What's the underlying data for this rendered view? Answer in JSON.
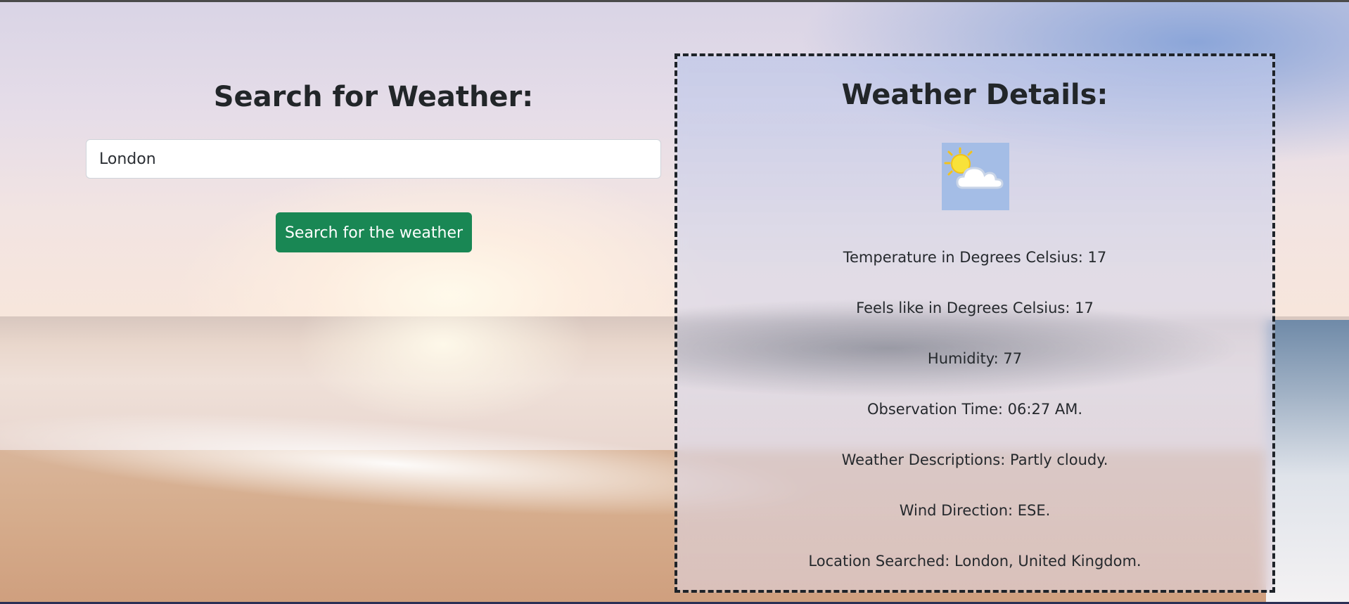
{
  "search": {
    "title": "Search for Weather:",
    "input_value": "London",
    "button_label": "Search for the weather"
  },
  "details": {
    "title": "Weather Details:",
    "icon": "partly-cloudy-icon",
    "temperature": "Temperature in Degrees Celsius: 17",
    "feels_like": "Feels like in Degrees Celsius: 17",
    "humidity": "Humidity: 77",
    "observation_time": "Observation Time: 06:27 AM.",
    "descriptions": "Weather Descriptions: Partly cloudy.",
    "wind_direction": "Wind Direction: ESE.",
    "location": "Location Searched: London, United Kingdom."
  },
  "colors": {
    "button_bg": "#198754",
    "text": "#222629",
    "panel_border": "#1e2329"
  }
}
